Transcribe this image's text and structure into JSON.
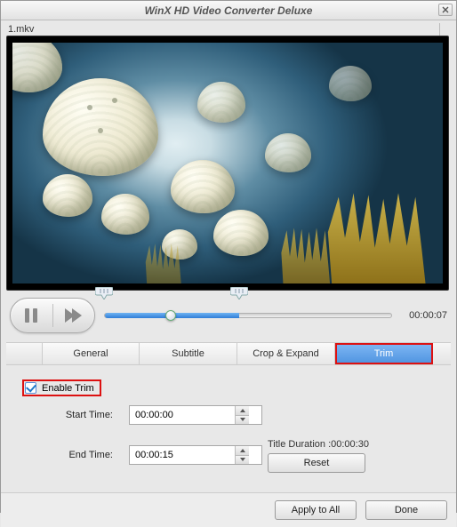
{
  "window": {
    "title": "WinX HD Video Converter Deluxe"
  },
  "file": {
    "name": "1.mkv"
  },
  "player": {
    "elapsed": "00:00:07",
    "progress_pct": 23,
    "trim_start_pct": 0,
    "trim_end_pct": 47
  },
  "tabs": {
    "items": [
      {
        "label": "General",
        "active": false
      },
      {
        "label": "Subtitle",
        "active": false
      },
      {
        "label": "Crop & Expand",
        "active": false
      },
      {
        "label": "Trim",
        "active": true
      }
    ]
  },
  "trim": {
    "enable_label": "Enable Trim",
    "enable_checked": true,
    "start_label": "Start Time:",
    "start_value": "00:00:00",
    "end_label": "End Time:",
    "end_value": "00:00:15",
    "duration_label": "Title Duration :00:00:30",
    "reset_label": "Reset"
  },
  "footer": {
    "apply_all_label": "Apply to All",
    "done_label": "Done"
  }
}
